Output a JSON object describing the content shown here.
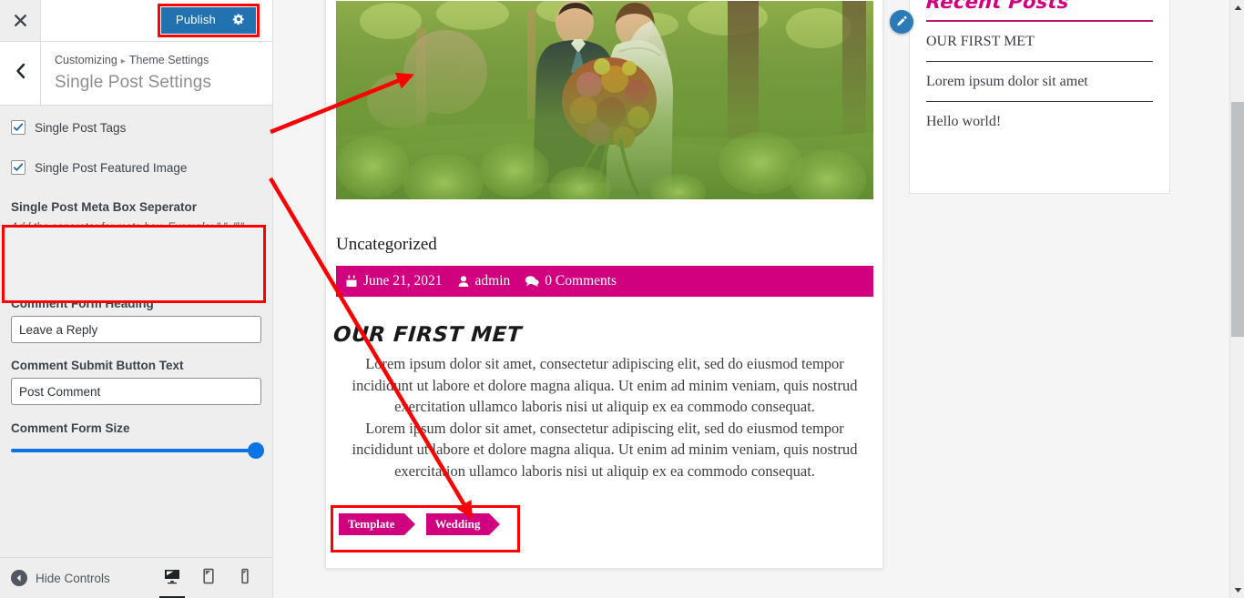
{
  "sidebar": {
    "close_icon": "close-icon",
    "publish": {
      "label": "Publish",
      "gear_icon": "gear-icon",
      "color": "#2271b1"
    },
    "breadcrumb": {
      "root": "Customizing",
      "separator": "▸",
      "parent": "Theme Settings"
    },
    "panel_title": "Single Post Settings",
    "back_icon": "chevron-left-icon",
    "checkboxes": [
      {
        "label": "Single Post Tags",
        "checked": true
      },
      {
        "label": "Single Post Featured Image",
        "checked": true
      }
    ],
    "fields": [
      {
        "label": "Single Post Meta Box Seperator",
        "description": "Add the seperator for meta box. Example: \",\", \"|\", \"/\", etc.",
        "value": "",
        "placeholder": ""
      },
      {
        "label": "Comment Form Heading",
        "description": "",
        "value": "Leave a Reply",
        "placeholder": ""
      },
      {
        "label": "Comment Submit Button Text",
        "description": "",
        "value": "Post Comment",
        "placeholder": ""
      }
    ],
    "slider": {
      "label": "Comment Form Size",
      "percent": 100,
      "color": "#0a74e6"
    },
    "footer": {
      "hide_controls": "Hide Controls",
      "devices": [
        {
          "name": "desktop",
          "active": true
        },
        {
          "name": "tablet",
          "active": false
        },
        {
          "name": "mobile",
          "active": false
        }
      ]
    }
  },
  "preview": {
    "featured_image_alt": "Bride and groom embracing in a sunlit forest with a bright bouquet",
    "category": "Uncategorized",
    "meta": [
      {
        "icon": "calendar-icon",
        "text": "June 21, 2021"
      },
      {
        "icon": "user-icon",
        "text": "admin"
      },
      {
        "icon": "comments-icon",
        "text": "0 Comments"
      }
    ],
    "meta_bar_color": "#d1007f",
    "post_title": "OUR FIRST MET",
    "paragraphs": [
      "Lorem ipsum dolor sit amet, consectetur adipiscing elit, sed do eiusmod tempor incididunt ut labore et dolore magna aliqua. Ut enim ad minim veniam, quis nostrud exercitation ullamco laboris nisi ut aliquip ex ea commodo consequat.",
      "Lorem ipsum dolor sit amet, consectetur adipiscing elit, sed do eiusmod tempor incididunt ut labore et dolore magna aliqua. Ut enim ad minim veniam, quis nostrud exercitation ullamco laboris nisi ut aliquip ex ea commodo consequat."
    ],
    "tags": [
      "Template",
      "Wedding"
    ],
    "widget": {
      "edit_icon": "pencil-edit-icon",
      "title": "Recent Posts",
      "title_color": "#d1007f",
      "items": [
        "OUR FIRST MET",
        "Lorem ipsum dolor sit amet",
        "Hello world!"
      ]
    }
  },
  "annotations": {
    "highlight_color": "#ff0000",
    "boxes": [
      "publish-button",
      "checkbox-group",
      "post-tags"
    ],
    "arrows": [
      "checkbox-group-to-featured-image",
      "checkbox-group-to-post-tags"
    ]
  }
}
